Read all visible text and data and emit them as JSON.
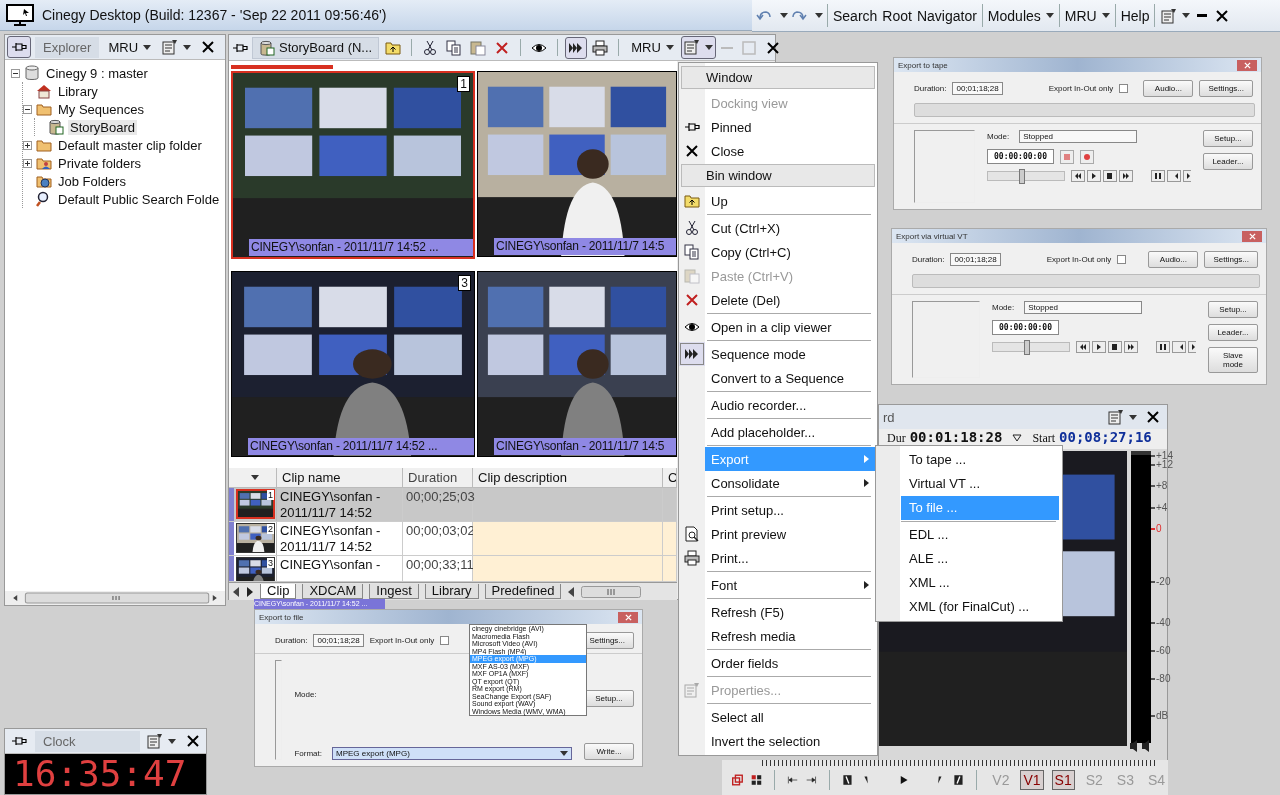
{
  "window": {
    "title": "Cinegy Desktop (Build: 12367 - 'Sep 22 2011 09:56:46')"
  },
  "main_toolbar": {
    "groups": [
      [
        {
          "label": "Search",
          "dropdown": false
        },
        {
          "label": "Root",
          "dropdown": false
        },
        {
          "label": "Navigator",
          "dropdown": false
        }
      ],
      [
        {
          "label": "Modules",
          "dropdown": true
        }
      ],
      [
        {
          "label": "MRU",
          "dropdown": true
        }
      ],
      [
        {
          "label": "Help",
          "dropdown": false
        }
      ]
    ]
  },
  "explorer": {
    "pinned": true,
    "tab": "Explorer",
    "mru": "MRU",
    "tree": [
      {
        "label": "Cinegy 9 : master",
        "kind": "database",
        "selected": false,
        "expanded": true,
        "children": [
          {
            "label": "Library",
            "kind": "house",
            "selected": false
          },
          {
            "label": "My Sequences",
            "kind": "folder",
            "selected": false,
            "expanded": true,
            "children": [
              {
                "label": "StoryBoard",
                "kind": "bin",
                "selected": true
              }
            ]
          },
          {
            "label": "Default master clip folder",
            "kind": "folder",
            "selected": false,
            "expanded": false
          },
          {
            "label": "Private folders",
            "kind": "people-folder",
            "selected": false,
            "expanded": false
          },
          {
            "label": "Job Folders",
            "kind": "globe-folder",
            "selected": false
          },
          {
            "label": "Default Public Search Folde",
            "kind": "search",
            "selected": false
          }
        ]
      }
    ]
  },
  "storyboard": {
    "pinned": false,
    "tab": "StoryBoard (N...",
    "mru": "MRU",
    "sequence_mode": true,
    "thumbnails": [
      {
        "number": "1",
        "caption": "CINEGY\\sonfan - 2011/11/7 14:52 ...",
        "selected": true
      },
      {
        "caption": "CINEGY\\sonfan - 2011/11/7 14:5",
        "selected": false
      },
      {
        "number": "3",
        "caption": "CINEGY\\sonfan - 2011/11/7 14:52 ...",
        "selected": false
      },
      {
        "caption": "CINEGY\\sonfan - 2011/11/7 14:5",
        "selected": false
      }
    ]
  },
  "clip_table": {
    "columns": [
      "Clip name",
      "Duration",
      "Clip description",
      "C"
    ],
    "rows": [
      {
        "number": "1",
        "name": "CINEGY\\sonfan - 2011/11/7 14:52",
        "duration": "00;00;25;03",
        "selected": true
      },
      {
        "number": "2",
        "name": "CINEGY\\sonfan - 2011/11/7 14:52",
        "duration": "00;00;03;02",
        "selected": false
      },
      {
        "number": "3",
        "name": "CINEGY\\sonfan -",
        "duration": "00;00;33;11",
        "selected": false
      }
    ]
  },
  "bin_tabs": [
    {
      "label": "Clip",
      "selected": true
    },
    {
      "label": "XDCAM",
      "selected": false
    },
    {
      "label": "Ingest",
      "selected": false
    },
    {
      "label": "Library",
      "selected": false
    },
    {
      "label": "Predefined",
      "selected": false
    }
  ],
  "context_menu": {
    "items": [
      {
        "kind": "header",
        "label": "Window"
      },
      {
        "kind": "plain",
        "label": "Docking view",
        "disabled": true,
        "selected": false,
        "checked": false,
        "submenu": false
      },
      {
        "kind": "pin",
        "label": "Pinned",
        "disabled": false,
        "selected": false,
        "checked": false,
        "submenu": false
      },
      {
        "kind": "close",
        "label": "Close",
        "disabled": false,
        "selected": false,
        "checked": false,
        "submenu": false
      },
      {
        "kind": "header",
        "label": "Bin window"
      },
      {
        "kind": "up",
        "label": "Up",
        "disabled": false,
        "selected": false,
        "checked": false,
        "submenu": false
      },
      {
        "kind": "separator"
      },
      {
        "kind": "cut",
        "label": "Cut (Ctrl+X)",
        "disabled": false,
        "selected": false,
        "checked": false,
        "submenu": false
      },
      {
        "kind": "copy",
        "label": "Copy (Ctrl+C)",
        "disabled": false,
        "selected": false,
        "checked": false,
        "submenu": false
      },
      {
        "kind": "paste",
        "label": "Paste (Ctrl+V)",
        "disabled": true,
        "selected": false,
        "checked": false,
        "submenu": false
      },
      {
        "kind": "delete",
        "label": "Delete (Del)",
        "disabled": false,
        "selected": false,
        "checked": false,
        "submenu": false
      },
      {
        "kind": "separator"
      },
      {
        "kind": "view",
        "label": "Open in a clip viewer",
        "disabled": false,
        "selected": false,
        "checked": false,
        "submenu": false
      },
      {
        "kind": "separator"
      },
      {
        "kind": "sequence",
        "label": "Sequence mode",
        "disabled": false,
        "selected": false,
        "checked": true,
        "submenu": false
      },
      {
        "kind": "plain",
        "label": "Convert to a Sequence",
        "disabled": false,
        "selected": false,
        "checked": false,
        "submenu": false
      },
      {
        "kind": "separator"
      },
      {
        "kind": "plain",
        "label": "Audio recorder...",
        "disabled": false,
        "selected": false,
        "checked": false,
        "submenu": false
      },
      {
        "kind": "separator"
      },
      {
        "kind": "plain",
        "label": "Add placeholder...",
        "disabled": false,
        "selected": false,
        "checked": false,
        "submenu": false
      },
      {
        "kind": "separator"
      },
      {
        "kind": "plain",
        "label": "Export",
        "disabled": false,
        "selected": true,
        "checked": false,
        "submenu": true
      },
      {
        "kind": "plain",
        "label": "Consolidate",
        "disabled": false,
        "selected": false,
        "checked": false,
        "submenu": true
      },
      {
        "kind": "separator"
      },
      {
        "kind": "plain",
        "label": "Print setup...",
        "disabled": false,
        "selected": false,
        "checked": false,
        "submenu": false
      },
      {
        "kind": "preview",
        "label": "Print preview",
        "disabled": false,
        "selected": false,
        "checked": false,
        "submenu": false
      },
      {
        "kind": "print",
        "label": "Print...",
        "disabled": false,
        "selected": false,
        "checked": false,
        "submenu": false
      },
      {
        "kind": "separator"
      },
      {
        "kind": "plain",
        "label": "Font",
        "disabled": false,
        "selected": false,
        "checked": false,
        "submenu": true
      },
      {
        "kind": "separator"
      },
      {
        "kind": "plain",
        "label": "Refresh (F5)",
        "disabled": false,
        "selected": false,
        "checked": false,
        "submenu": false
      },
      {
        "kind": "plain",
        "label": "Refresh media",
        "disabled": false,
        "selected": false,
        "checked": false,
        "submenu": false
      },
      {
        "kind": "separator"
      },
      {
        "kind": "plain",
        "label": "Order fields",
        "disabled": false,
        "selected": false,
        "checked": false,
        "submenu": false
      },
      {
        "kind": "separator"
      },
      {
        "kind": "properties",
        "label": "Properties...",
        "disabled": true,
        "selected": false,
        "checked": false,
        "submenu": false
      },
      {
        "kind": "separator"
      },
      {
        "kind": "plain",
        "label": "Select all",
        "disabled": false,
        "selected": false,
        "checked": false,
        "submenu": false
      },
      {
        "kind": "plain",
        "label": "Invert the selection",
        "disabled": false,
        "selected": false,
        "checked": false,
        "submenu": false
      }
    ]
  },
  "export_submenu": {
    "items": [
      {
        "kind": "item",
        "label": "To tape ...",
        "selected": false
      },
      {
        "kind": "item",
        "label": "Virtual VT ...",
        "selected": false
      },
      {
        "kind": "item",
        "label": "To file ...",
        "selected": true
      },
      {
        "kind": "separator"
      },
      {
        "kind": "item",
        "label": "EDL ...",
        "selected": false
      },
      {
        "kind": "item",
        "label": "ALE ...",
        "selected": false
      },
      {
        "kind": "item",
        "label": "XML ...",
        "selected": false
      },
      {
        "kind": "item",
        "label": "XML (for FinalCut) ...",
        "selected": false
      }
    ]
  },
  "dialogs": {
    "tape": {
      "kind": "tape",
      "title": "Export to tape",
      "duration_label": "Duration:",
      "duration": "00;01;18;28",
      "inout_label": "Export In-Out only",
      "inout_checked": false,
      "buttons_top": [
        "Audio...",
        "Settings..."
      ],
      "mode_label": "Mode:",
      "mode": "Stopped",
      "buttons_side": [
        "Setup...",
        "Leader..."
      ],
      "timecode": "00:00:00:00",
      "slider": {
        "level": 0.45
      }
    },
    "vt": {
      "kind": "vt",
      "title": "Export via virtual VT",
      "duration_label": "Duration:",
      "duration": "00;01;18;28",
      "inout_label": "Export In-Out only",
      "inout_checked": false,
      "buttons_top": [
        "Audio...",
        "Settings..."
      ],
      "mode_label": "Mode:",
      "mode": "Stopped",
      "buttons_side": [
        "Setup...",
        "Leader...",
        "Slave mode"
      ],
      "timecode": "00:00:00:00",
      "slider": {
        "level": 0.45
      }
    },
    "file": {
      "kind": "file",
      "drag_label": "CINEGY\\sonfan - 2011/11/7 14:52 ...",
      "title": "Export to file",
      "duration_label": "Duration:",
      "duration": "00;01;18;28",
      "inout_label": "Export In-Out only",
      "inout_checked": false,
      "buttons_top": [
        "Settings..."
      ],
      "mode_label": "Mode:",
      "buttons_side": [
        "Setup..."
      ],
      "format_label": "Format:",
      "format": "MPEG export (MPG)",
      "write": "Write...",
      "format_options": [
        {
          "label": "cinegy cinebridge (AVI)",
          "selected": false
        },
        {
          "label": "Macromedia Flash",
          "selected": false
        },
        {
          "label": "Microsoft Video (AVI)",
          "selected": false
        },
        {
          "label": "MP4 Flash (MP4)",
          "selected": false
        },
        {
          "label": "MPEG export (MPG)",
          "selected": true
        },
        {
          "label": "MXF AS-03 (MXF)",
          "selected": false
        },
        {
          "label": "MXF OP1A (MXF)",
          "selected": false
        },
        {
          "label": "QT export (QT)",
          "selected": false
        },
        {
          "label": "RM export (RM)",
          "selected": false
        },
        {
          "label": "SeaChange Export (SAF)",
          "selected": false
        },
        {
          "label": "Sound export (WAV)",
          "selected": false
        },
        {
          "label": "Windows Media (WMV, WMA)",
          "selected": false
        }
      ]
    }
  },
  "viewer": {
    "title": "rd",
    "dur_label": "Dur",
    "duration": "00:01:18:28",
    "start_label": "Start",
    "start": "00;08;27;16",
    "meter_scale": [
      {
        "label": "+14",
        "color": "#555555"
      },
      {
        "label": "+12",
        "color": "#555555"
      },
      {
        "label": "+8",
        "color": "#555555"
      },
      {
        "label": "+4",
        "color": "#555555"
      },
      {
        "label": "0",
        "color": "#e03030"
      },
      {
        "label": "-20",
        "color": "#555555"
      },
      {
        "label": "-40",
        "color": "#555555"
      },
      {
        "label": "-60",
        "color": "#555555"
      },
      {
        "label": "-80",
        "color": "#555555"
      },
      {
        "label": "dB",
        "color": "#555555"
      }
    ],
    "tracks": [
      {
        "label": "V2",
        "selected": false
      },
      {
        "label": "V1",
        "selected": true
      },
      {
        "label": "S1",
        "selected": true
      },
      {
        "label": "S2",
        "selected": false
      },
      {
        "label": "S3",
        "selected": false
      },
      {
        "label": "S4",
        "selected": false
      }
    ]
  },
  "clock": {
    "pinned": false,
    "title": "Clock",
    "time": "16:35:47"
  }
}
